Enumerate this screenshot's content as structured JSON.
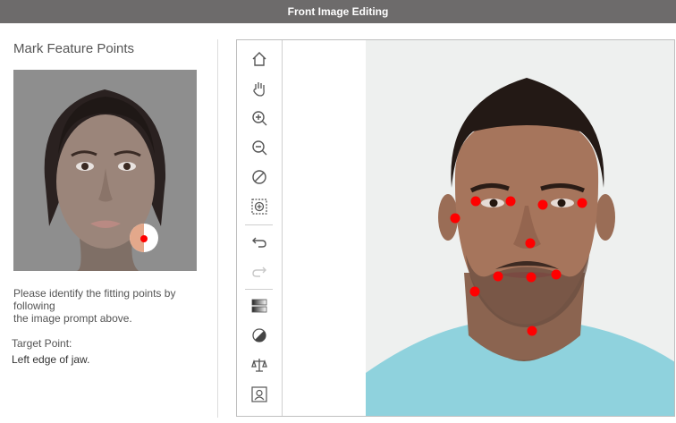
{
  "window": {
    "title": "Front Image Editing"
  },
  "left_panel": {
    "heading": "Mark Feature Points",
    "instruction": "Please identify the fitting points by following\nthe image prompt above.",
    "target_label": "Target Point:",
    "target_value": "Left edge of jaw."
  },
  "toolbar": {
    "tools": [
      {
        "name": "home-icon",
        "interactable": true
      },
      {
        "name": "hand-pan-icon",
        "interactable": true
      },
      {
        "name": "zoom-in-icon",
        "interactable": true
      },
      {
        "name": "zoom-out-icon",
        "interactable": true
      },
      {
        "name": "reset-zoom-icon",
        "interactable": true
      },
      {
        "name": "fit-to-window-icon",
        "interactable": true
      },
      {
        "name": "undo-icon",
        "interactable": true
      },
      {
        "name": "redo-icon",
        "interactable": false
      },
      {
        "name": "gradient-icon",
        "interactable": true
      },
      {
        "name": "contrast-icon",
        "interactable": true
      },
      {
        "name": "balance-icon",
        "interactable": true
      },
      {
        "name": "portrait-frame-icon",
        "interactable": true
      }
    ]
  },
  "feature_points": {
    "color": "#ff0000",
    "count": 12
  },
  "colors": {
    "titlebar": "#6d6b6b",
    "marker": "#ff0000",
    "disabled_tool": "#c8c8c8"
  }
}
